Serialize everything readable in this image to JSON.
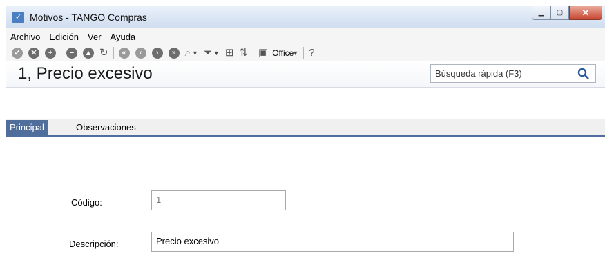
{
  "window": {
    "title": "Motivos - TANGO Compras"
  },
  "menu": {
    "items": [
      {
        "accel": "A",
        "rest": "rchivo"
      },
      {
        "accel": "E",
        "rest": "dición"
      },
      {
        "accel": "V",
        "rest": "er"
      },
      {
        "accel": "",
        "pre": "A",
        "accel2": "y",
        "rest": "uda"
      }
    ]
  },
  "toolbar": {
    "office_label": "Office"
  },
  "record": {
    "title": "1, Precio excesivo"
  },
  "search": {
    "placeholder": "Búsqueda rápida (F3)"
  },
  "tabs": [
    {
      "label": "Principal",
      "active": true
    },
    {
      "label": "Observaciones",
      "active": false
    }
  ],
  "form": {
    "codigo": {
      "label": "Código:",
      "value": "1"
    },
    "descripcion": {
      "label": "Descripción:",
      "value": "Precio excesivo"
    }
  },
  "colors": {
    "accent": "#4f6e9c",
    "close": "#c7462f"
  }
}
